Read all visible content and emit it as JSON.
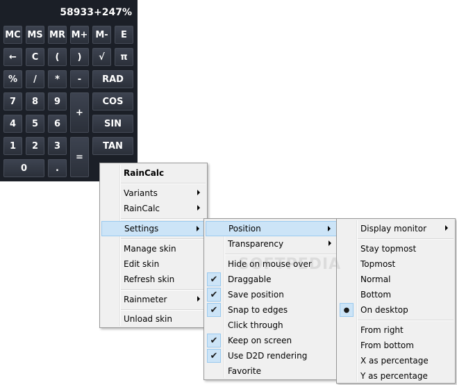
{
  "calculator": {
    "display": "58933+247%",
    "keys": {
      "mc": "MC",
      "ms": "MS",
      "mr": "MR",
      "mplus": "M+",
      "mminus": "M-",
      "e": "E",
      "back": "←",
      "c": "C",
      "lparen": "(",
      "rparen": ")",
      "sqrt": "√",
      "pi": "π",
      "percent": "%",
      "divide": "/",
      "multiply": "*",
      "minus": "-",
      "rad": "RAD",
      "k7": "7",
      "k8": "8",
      "k9": "9",
      "plus": "+",
      "cos": "COS",
      "k4": "4",
      "k5": "5",
      "k6": "6",
      "sin": "SIN",
      "k1": "1",
      "k2": "2",
      "k3": "3",
      "equals": "=",
      "tan": "TAN",
      "k0": "0",
      "dot": "."
    }
  },
  "menu_main": {
    "title": "RainCalc",
    "variants": "Variants",
    "raincalc": "RainCalc",
    "settings": "Settings",
    "manage_skin": "Manage skin",
    "edit_skin": "Edit skin",
    "refresh_skin": "Refresh skin",
    "rainmeter": "Rainmeter",
    "unload_skin": "Unload skin"
  },
  "menu_settings": {
    "position": "Position",
    "transparency": "Transparency",
    "hide_on_mouse_over": "Hide on mouse over",
    "draggable": "Draggable",
    "save_position": "Save position",
    "snap_to_edges": "Snap to edges",
    "click_through": "Click through",
    "keep_on_screen": "Keep on screen",
    "use_d2d": "Use D2D rendering",
    "favorite": "Favorite",
    "checked": {
      "draggable": true,
      "save_position": true,
      "snap_to_edges": true,
      "keep_on_screen": true,
      "use_d2d": true
    }
  },
  "menu_position": {
    "display_monitor": "Display monitor",
    "stay_topmost": "Stay topmost",
    "topmost": "Topmost",
    "normal": "Normal",
    "bottom": "Bottom",
    "on_desktop": "On desktop",
    "from_right": "From right",
    "from_bottom": "From bottom",
    "x_as_percentage": "X as percentage",
    "y_as_percentage": "Y as percentage",
    "selected": "On desktop"
  },
  "watermark": "SOFTPEDIA",
  "colors": {
    "calc_bg": "#1b1f27",
    "menu_bg": "#f0f0f0",
    "highlight": "#cce4f7",
    "highlight_border": "#99c9ef"
  },
  "icons": {
    "checkmark": "✔",
    "radio": "●",
    "submenu": "submenu-arrow-icon"
  }
}
